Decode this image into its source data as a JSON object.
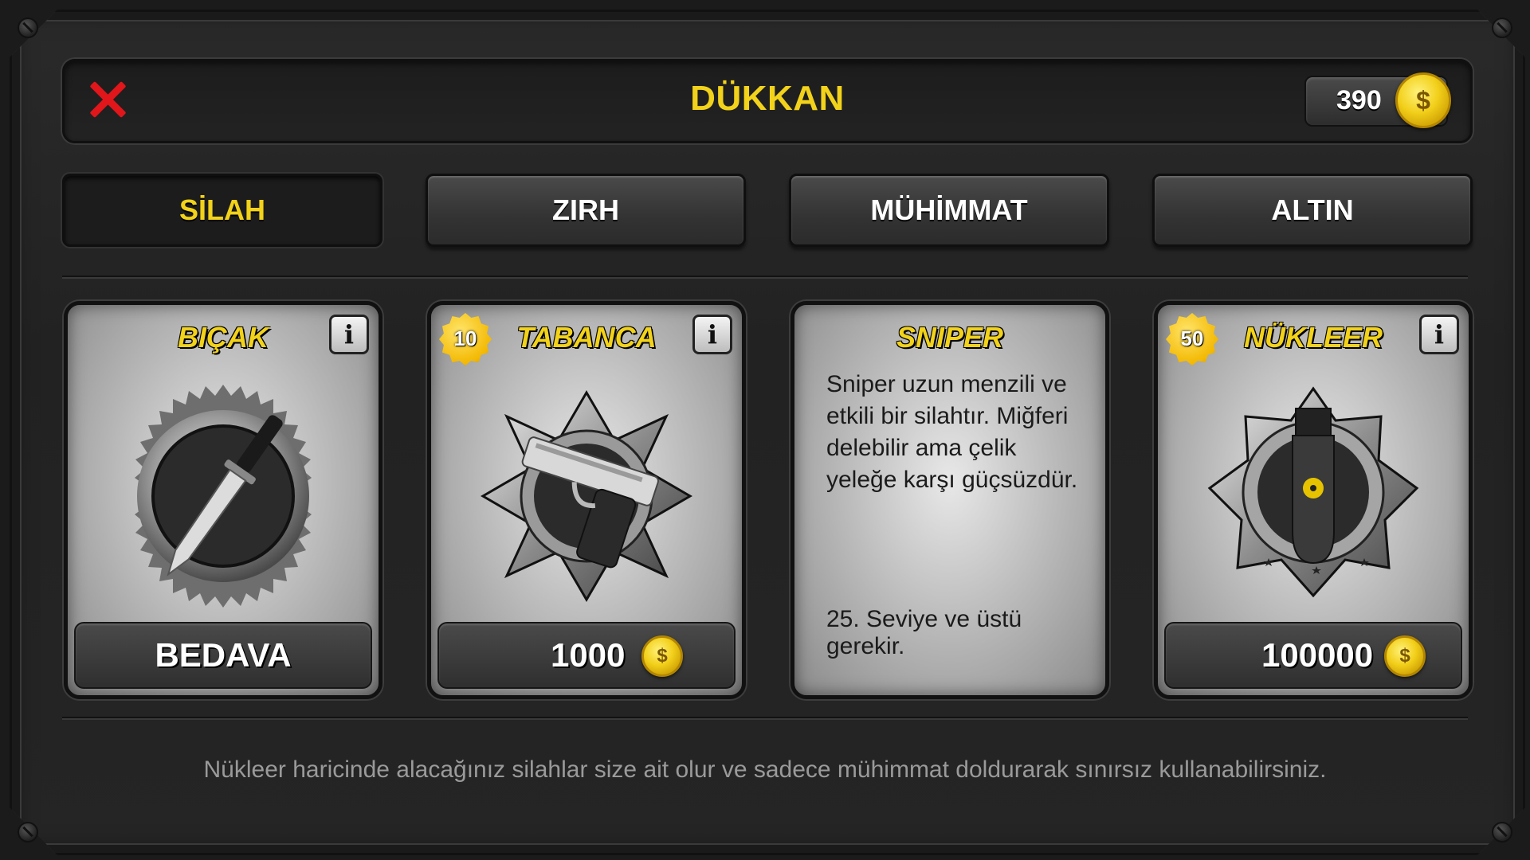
{
  "header": {
    "title": "DÜKKAN",
    "balance": "390",
    "coin_symbol": "$"
  },
  "tabs": [
    {
      "label": "SİLAH",
      "active": true
    },
    {
      "label": "ZIRH",
      "active": false
    },
    {
      "label": "MÜHİMMAT",
      "active": false
    },
    {
      "label": "ALTIN",
      "active": false
    }
  ],
  "cards": [
    {
      "title": "BIÇAK",
      "price": "BEDAVA",
      "icon": "knife-emblem-icon"
    },
    {
      "title": "TABANCA",
      "level": "10",
      "price": "1000",
      "icon": "pistol-emblem-icon"
    },
    {
      "title": "SNIPER",
      "description": "Sniper uzun menzili ve etkili bir silahtır. Miğferi delebilir ama çelik yeleğe karşı güçsüzdür.",
      "requirement": "25. Seviye ve üstü gerekir."
    },
    {
      "title": "NÜKLEER",
      "level": "50",
      "price": "100000",
      "icon": "nuke-emblem-icon"
    }
  ],
  "footer": {
    "note": "Nükleer haricinde alacağınız silahlar size ait olur ve sadece mühimmat doldurarak sınırsız kullanabilirsiniz."
  },
  "colors": {
    "accent": "#f2d21a",
    "close": "#e0161b",
    "panel": "#2a2a2a"
  }
}
